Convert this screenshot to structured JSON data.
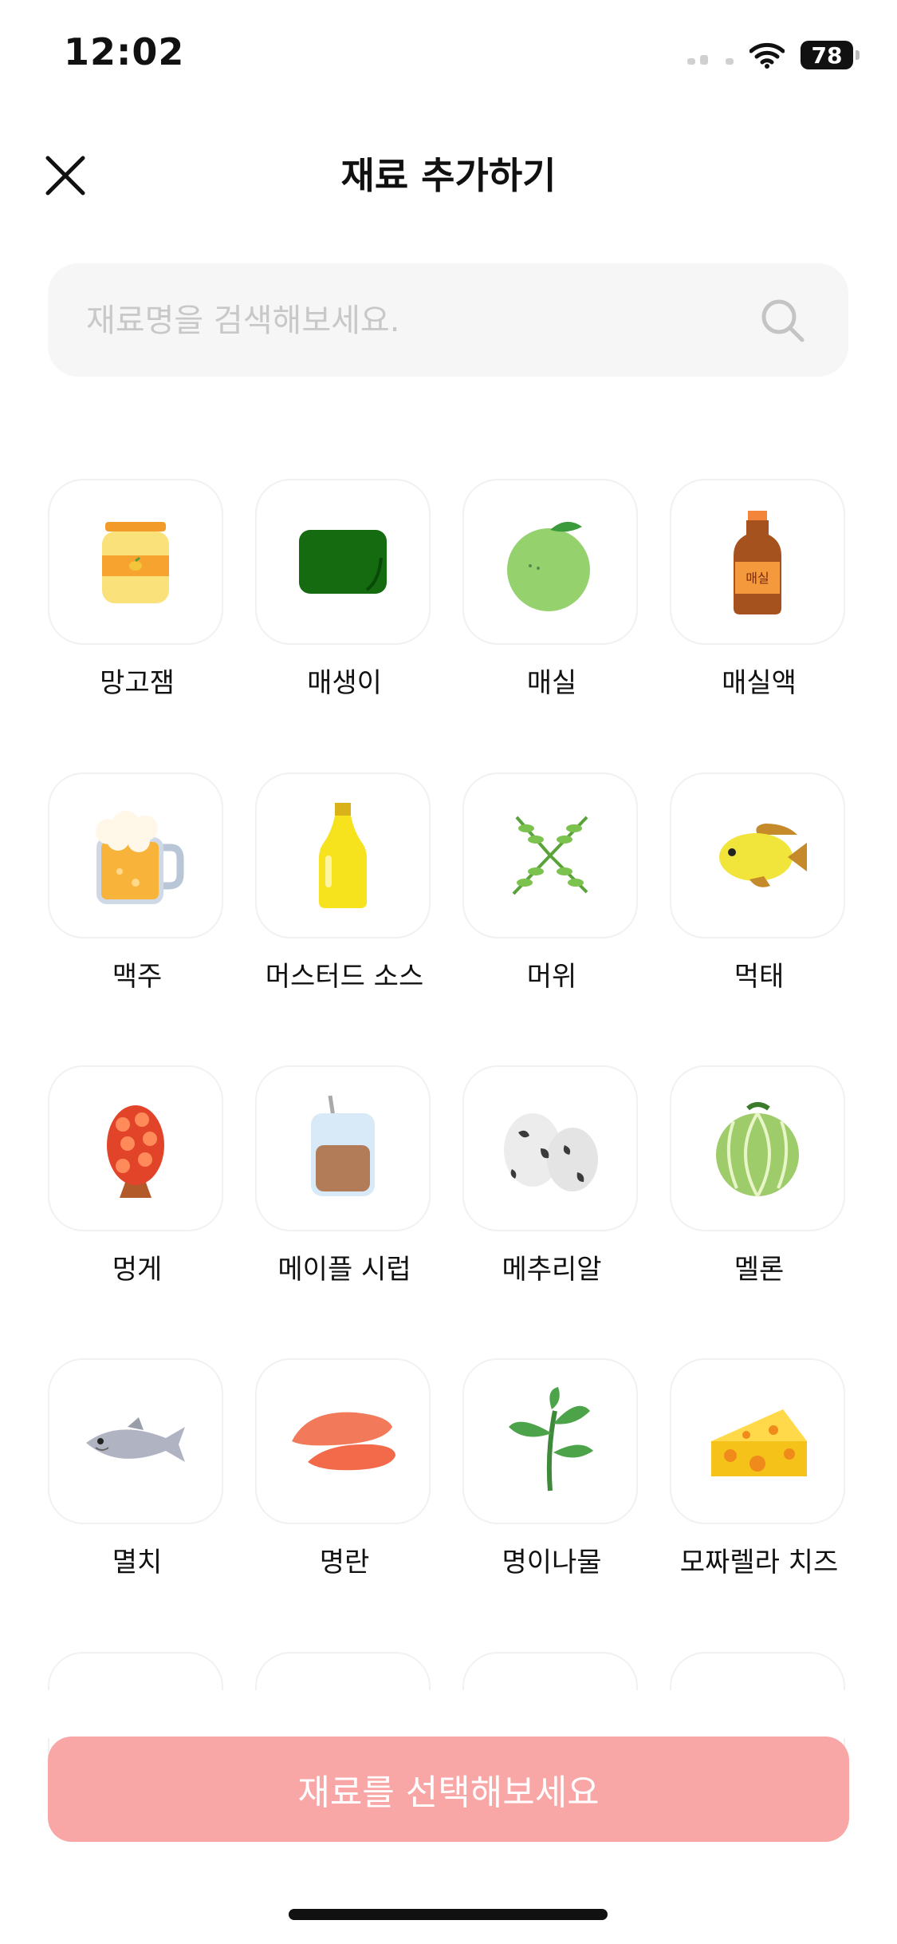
{
  "status": {
    "time": "12:02",
    "battery": "78"
  },
  "header": {
    "title": "재료 추가하기"
  },
  "search": {
    "placeholder": "재료명을 검색해보세요."
  },
  "ingredients": [
    {
      "label": "망고잼",
      "icon": "jam-jar-icon"
    },
    {
      "label": "매생이",
      "icon": "seaweed-icon"
    },
    {
      "label": "매실",
      "icon": "green-plum-icon"
    },
    {
      "label": "매실액",
      "icon": "plum-syrup-bottle-icon"
    },
    {
      "label": "맥주",
      "icon": "beer-mug-icon"
    },
    {
      "label": "머스터드 소스",
      "icon": "mustard-bottle-icon"
    },
    {
      "label": "머위",
      "icon": "butterbur-leaf-icon"
    },
    {
      "label": "먹태",
      "icon": "dried-fish-icon"
    },
    {
      "label": "멍게",
      "icon": "sea-squirt-icon"
    },
    {
      "label": "메이플 시럽",
      "icon": "maple-syrup-jar-icon"
    },
    {
      "label": "메추리알",
      "icon": "quail-eggs-icon"
    },
    {
      "label": "멜론",
      "icon": "melon-icon"
    },
    {
      "label": "멸치",
      "icon": "anchovy-icon"
    },
    {
      "label": "명란",
      "icon": "pollock-roe-icon"
    },
    {
      "label": "명이나물",
      "icon": "wild-garlic-leaf-icon"
    },
    {
      "label": "모짜렐라 치즈",
      "icon": "cheese-icon"
    }
  ],
  "jar_label": "매실",
  "cta": {
    "label": "재료를 선택해보세요"
  },
  "colors": {
    "cta": "#f9a6a6",
    "search_bg": "#f6f6f6"
  }
}
